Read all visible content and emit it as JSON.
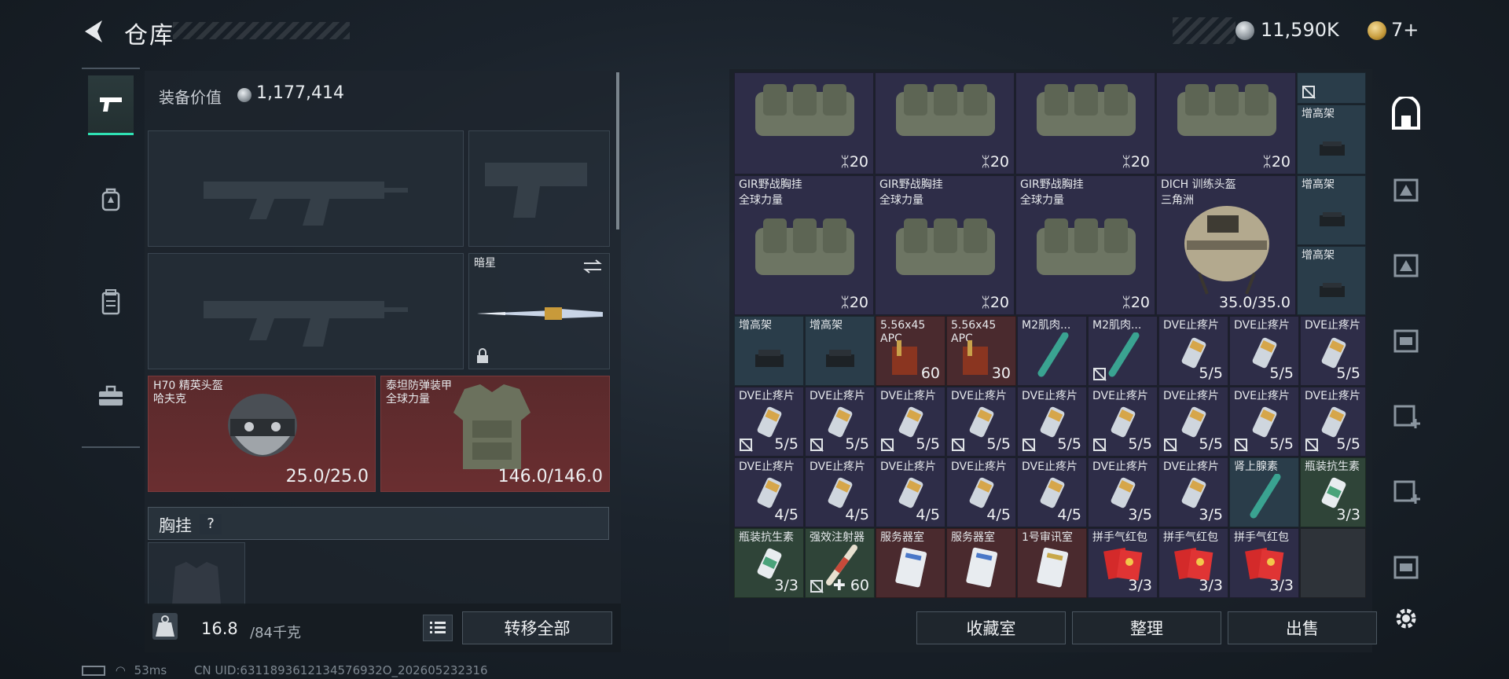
{
  "header": {
    "title": "仓库",
    "currency": {
      "silver": "11,590K",
      "gold": "7+"
    }
  },
  "left_nav": {
    "items": [
      "pistol-icon",
      "backpack-icon",
      "rig-icon",
      "toolbox-icon"
    ],
    "active": 0
  },
  "equipment": {
    "value_label": "装备价值",
    "value": "1,177,414",
    "melee": {
      "name": "暗星"
    },
    "helmet": {
      "name": "H70 精英头盔",
      "sub": "哈夫克",
      "durability": "25.0/25.0"
    },
    "armor": {
      "name": "泰坦防弹装甲",
      "sub": "全球力量",
      "durability": "146.0/146.0"
    },
    "chest_rig": {
      "label": "胸挂",
      "help": "?"
    }
  },
  "capacity": {
    "current": "16.8",
    "max": "/84千克"
  },
  "buttons": {
    "transfer_all": "转移全部",
    "collection_room": "收藏室",
    "organize": "整理",
    "sell": "出售"
  },
  "status": {
    "ping": "53ms",
    "uid": "CN UID:6311893612134576932O_202605232316"
  },
  "inventory": {
    "row1": [
      {
        "count": "20"
      },
      {
        "count": "20"
      },
      {
        "count": "20"
      },
      {
        "count": "20"
      }
    ],
    "row1_side": {
      "name": "增高架"
    },
    "row2": [
      {
        "name": "GIR野战胸挂",
        "sub": "全球力量",
        "count": "20"
      },
      {
        "name": "GIR野战胸挂",
        "sub": "全球力量",
        "count": "20"
      },
      {
        "name": "GIR野战胸挂",
        "sub": "全球力量",
        "count": "20"
      }
    ],
    "helmet2": {
      "name": "DICH 训练头盔",
      "sub": "三角洲",
      "durability": "35.0/35.0"
    },
    "side_stack": [
      {
        "name": "增高架"
      },
      {
        "name": "增高架"
      }
    ],
    "row3": [
      {
        "name": "增高架",
        "count": ""
      },
      {
        "name": "增高架",
        "count": ""
      },
      {
        "name": "5.56x45",
        "sub": "APC",
        "count": "60"
      },
      {
        "name": "5.56x45",
        "sub": "APC",
        "count": "30"
      },
      {
        "name": "M2肌肉...",
        "count": ""
      },
      {
        "name": "M2肌肉...",
        "count": ""
      },
      {
        "name": "DVE止疼片",
        "count": "5/5"
      },
      {
        "name": "DVE止疼片",
        "count": "5/5"
      },
      {
        "name": "DVE止疼片",
        "count": "5/5"
      }
    ],
    "row4": [
      {
        "name": "DVE止疼片",
        "count": "5/5"
      },
      {
        "name": "DVE止疼片",
        "count": "5/5"
      },
      {
        "name": "DVE止疼片",
        "count": "5/5"
      },
      {
        "name": "DVE止疼片",
        "count": "5/5"
      },
      {
        "name": "DVE止疼片",
        "count": "5/5"
      },
      {
        "name": "DVE止疼片",
        "count": "5/5"
      },
      {
        "name": "DVE止疼片",
        "count": "5/5"
      },
      {
        "name": "DVE止疼片",
        "count": "5/5"
      },
      {
        "name": "DVE止疼片",
        "count": "5/5"
      }
    ],
    "row5": [
      {
        "name": "DVE止疼片",
        "count": "4/5"
      },
      {
        "name": "DVE止疼片",
        "count": "4/5"
      },
      {
        "name": "DVE止疼片",
        "count": "4/5"
      },
      {
        "name": "DVE止疼片",
        "count": "4/5"
      },
      {
        "name": "DVE止疼片",
        "count": "4/5"
      },
      {
        "name": "DVE止疼片",
        "count": "3/5"
      },
      {
        "name": "DVE止疼片",
        "count": "3/5"
      },
      {
        "name": "肾上腺素",
        "count": ""
      },
      {
        "name": "瓶装抗生素",
        "count": "3/3"
      }
    ],
    "row6": [
      {
        "name": "瓶装抗生素",
        "count": "3/3"
      },
      {
        "name": "强效注射器",
        "count": "60"
      },
      {
        "name": "服务器室",
        "count": ""
      },
      {
        "name": "服务器室",
        "count": ""
      },
      {
        "name": "1号审讯室",
        "count": ""
      },
      {
        "name": "拼手气红包",
        "count": "3/3"
      },
      {
        "name": "拼手气红包",
        "count": "3/3"
      },
      {
        "name": "拼手气红包",
        "count": "3/3"
      }
    ]
  }
}
